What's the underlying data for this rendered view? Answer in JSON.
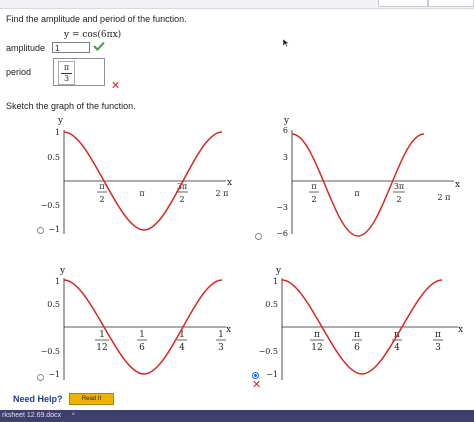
{
  "question": {
    "prompt": "Find the amplitude and period of the function.",
    "equation": "y = cos(6πx)"
  },
  "amplitude": {
    "label": "amplitude",
    "value": "1",
    "status": "correct",
    "status_icon": "check-icon",
    "status_color": "#3aa13a"
  },
  "period": {
    "label": "period",
    "numerator": "π",
    "denominator": "3",
    "status": "incorrect",
    "status_icon": "x-mark-icon",
    "status_color": "#d9241c"
  },
  "sketch": {
    "prompt": "Sketch the graph of the function.",
    "options": [
      {
        "id": "a",
        "selected": false,
        "y_axis_label": "y",
        "x_axis_label": "x",
        "y_ticks": [
          "1",
          "0.5",
          "−0.5",
          "−1"
        ],
        "x_ticks": [
          {
            "num": "π",
            "den": "2"
          },
          {
            "text": "π"
          },
          {
            "num": "3π",
            "den": "2"
          },
          {
            "text": "2 π"
          }
        ]
      },
      {
        "id": "b",
        "selected": false,
        "y_axis_label": "y",
        "x_axis_label": "x",
        "y_ticks": [
          "6",
          "3",
          "−3",
          "−6"
        ],
        "x_ticks": [
          {
            "num": "π",
            "den": "2"
          },
          {
            "text": "π"
          },
          {
            "num": "3π",
            "den": "2"
          },
          {
            "text": "2 π"
          }
        ]
      },
      {
        "id": "c",
        "selected": false,
        "y_axis_label": "y",
        "x_axis_label": "x",
        "y_ticks": [
          "1",
          "0.5",
          "−0.5",
          "−1"
        ],
        "x_ticks": [
          {
            "num": "1",
            "den": "12"
          },
          {
            "num": "1",
            "den": "6"
          },
          {
            "num": "1",
            "den": "4"
          },
          {
            "num": "1",
            "den": "3"
          }
        ]
      },
      {
        "id": "d",
        "selected": true,
        "status": "incorrect",
        "y_axis_label": "y",
        "x_axis_label": "x",
        "y_ticks": [
          "1",
          "0.5",
          "−0.5",
          "−1"
        ],
        "x_ticks": [
          {
            "num": "π",
            "den": "12"
          },
          {
            "num": "π",
            "den": "6"
          },
          {
            "num": "π",
            "den": "4"
          },
          {
            "num": "π",
            "den": "3"
          }
        ]
      }
    ],
    "curve_color": "#d9251f",
    "select_color": "#1e6ce0"
  },
  "help": {
    "label": "Need Help?",
    "read_it_label": "Read It",
    "button_color": "#f0b400"
  },
  "taskbar": {
    "file_label": "rksheet 12.69.docx",
    "caret": "^"
  }
}
